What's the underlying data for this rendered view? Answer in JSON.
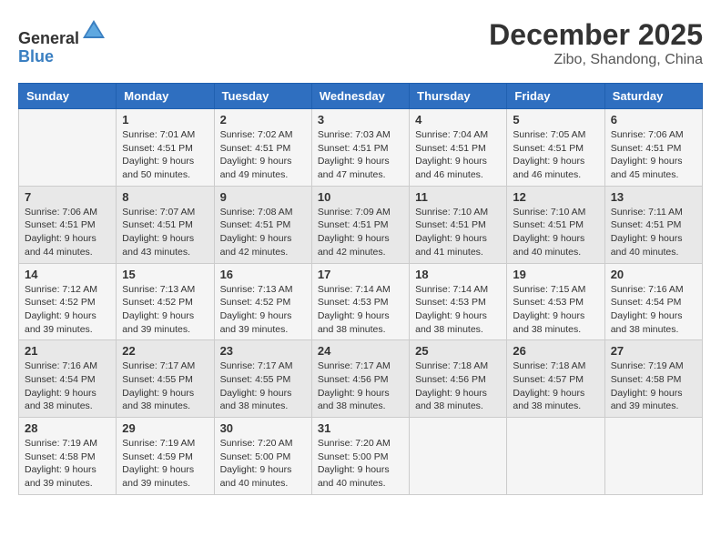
{
  "header": {
    "logo_general": "General",
    "logo_blue": "Blue",
    "month": "December 2025",
    "location": "Zibo, Shandong, China"
  },
  "weekdays": [
    "Sunday",
    "Monday",
    "Tuesday",
    "Wednesday",
    "Thursday",
    "Friday",
    "Saturday"
  ],
  "weeks": [
    [
      {
        "day": "",
        "info": ""
      },
      {
        "day": "1",
        "info": "Sunrise: 7:01 AM\nSunset: 4:51 PM\nDaylight: 9 hours\nand 50 minutes."
      },
      {
        "day": "2",
        "info": "Sunrise: 7:02 AM\nSunset: 4:51 PM\nDaylight: 9 hours\nand 49 minutes."
      },
      {
        "day": "3",
        "info": "Sunrise: 7:03 AM\nSunset: 4:51 PM\nDaylight: 9 hours\nand 47 minutes."
      },
      {
        "day": "4",
        "info": "Sunrise: 7:04 AM\nSunset: 4:51 PM\nDaylight: 9 hours\nand 46 minutes."
      },
      {
        "day": "5",
        "info": "Sunrise: 7:05 AM\nSunset: 4:51 PM\nDaylight: 9 hours\nand 46 minutes."
      },
      {
        "day": "6",
        "info": "Sunrise: 7:06 AM\nSunset: 4:51 PM\nDaylight: 9 hours\nand 45 minutes."
      }
    ],
    [
      {
        "day": "7",
        "info": "Sunrise: 7:06 AM\nSunset: 4:51 PM\nDaylight: 9 hours\nand 44 minutes."
      },
      {
        "day": "8",
        "info": "Sunrise: 7:07 AM\nSunset: 4:51 PM\nDaylight: 9 hours\nand 43 minutes."
      },
      {
        "day": "9",
        "info": "Sunrise: 7:08 AM\nSunset: 4:51 PM\nDaylight: 9 hours\nand 42 minutes."
      },
      {
        "day": "10",
        "info": "Sunrise: 7:09 AM\nSunset: 4:51 PM\nDaylight: 9 hours\nand 42 minutes."
      },
      {
        "day": "11",
        "info": "Sunrise: 7:10 AM\nSunset: 4:51 PM\nDaylight: 9 hours\nand 41 minutes."
      },
      {
        "day": "12",
        "info": "Sunrise: 7:10 AM\nSunset: 4:51 PM\nDaylight: 9 hours\nand 40 minutes."
      },
      {
        "day": "13",
        "info": "Sunrise: 7:11 AM\nSunset: 4:51 PM\nDaylight: 9 hours\nand 40 minutes."
      }
    ],
    [
      {
        "day": "14",
        "info": "Sunrise: 7:12 AM\nSunset: 4:52 PM\nDaylight: 9 hours\nand 39 minutes."
      },
      {
        "day": "15",
        "info": "Sunrise: 7:13 AM\nSunset: 4:52 PM\nDaylight: 9 hours\nand 39 minutes."
      },
      {
        "day": "16",
        "info": "Sunrise: 7:13 AM\nSunset: 4:52 PM\nDaylight: 9 hours\nand 39 minutes."
      },
      {
        "day": "17",
        "info": "Sunrise: 7:14 AM\nSunset: 4:53 PM\nDaylight: 9 hours\nand 38 minutes."
      },
      {
        "day": "18",
        "info": "Sunrise: 7:14 AM\nSunset: 4:53 PM\nDaylight: 9 hours\nand 38 minutes."
      },
      {
        "day": "19",
        "info": "Sunrise: 7:15 AM\nSunset: 4:53 PM\nDaylight: 9 hours\nand 38 minutes."
      },
      {
        "day": "20",
        "info": "Sunrise: 7:16 AM\nSunset: 4:54 PM\nDaylight: 9 hours\nand 38 minutes."
      }
    ],
    [
      {
        "day": "21",
        "info": "Sunrise: 7:16 AM\nSunset: 4:54 PM\nDaylight: 9 hours\nand 38 minutes."
      },
      {
        "day": "22",
        "info": "Sunrise: 7:17 AM\nSunset: 4:55 PM\nDaylight: 9 hours\nand 38 minutes."
      },
      {
        "day": "23",
        "info": "Sunrise: 7:17 AM\nSunset: 4:55 PM\nDaylight: 9 hours\nand 38 minutes."
      },
      {
        "day": "24",
        "info": "Sunrise: 7:17 AM\nSunset: 4:56 PM\nDaylight: 9 hours\nand 38 minutes."
      },
      {
        "day": "25",
        "info": "Sunrise: 7:18 AM\nSunset: 4:56 PM\nDaylight: 9 hours\nand 38 minutes."
      },
      {
        "day": "26",
        "info": "Sunrise: 7:18 AM\nSunset: 4:57 PM\nDaylight: 9 hours\nand 38 minutes."
      },
      {
        "day": "27",
        "info": "Sunrise: 7:19 AM\nSunset: 4:58 PM\nDaylight: 9 hours\nand 39 minutes."
      }
    ],
    [
      {
        "day": "28",
        "info": "Sunrise: 7:19 AM\nSunset: 4:58 PM\nDaylight: 9 hours\nand 39 minutes."
      },
      {
        "day": "29",
        "info": "Sunrise: 7:19 AM\nSunset: 4:59 PM\nDaylight: 9 hours\nand 39 minutes."
      },
      {
        "day": "30",
        "info": "Sunrise: 7:20 AM\nSunset: 5:00 PM\nDaylight: 9 hours\nand 40 minutes."
      },
      {
        "day": "31",
        "info": "Sunrise: 7:20 AM\nSunset: 5:00 PM\nDaylight: 9 hours\nand 40 minutes."
      },
      {
        "day": "",
        "info": ""
      },
      {
        "day": "",
        "info": ""
      },
      {
        "day": "",
        "info": ""
      }
    ]
  ]
}
